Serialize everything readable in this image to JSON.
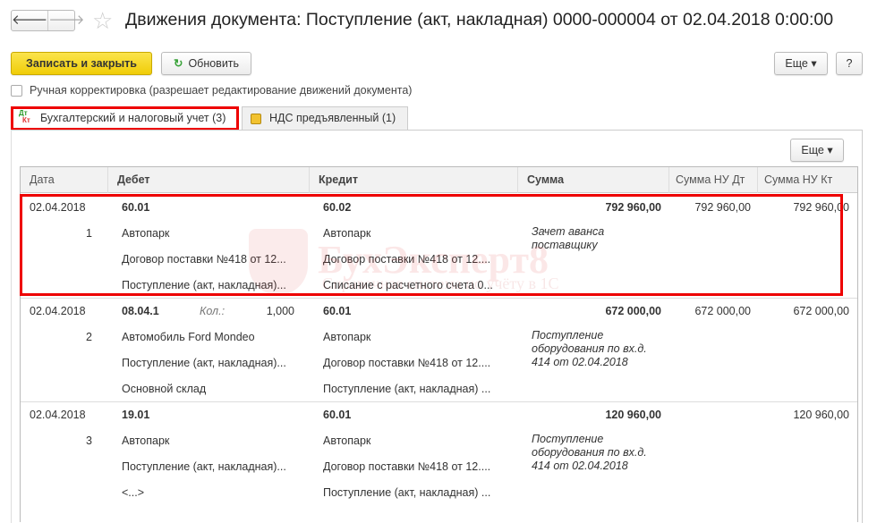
{
  "header": {
    "title": "Движения документа: Поступление (акт, накладная) 0000-000004 от 02.04.2018 0:00:00",
    "back": "🡐",
    "forward": "🡒",
    "star": "☆"
  },
  "toolbar": {
    "save_close": "Записать и закрыть",
    "refresh": "Обновить",
    "refresh_icon": "↻",
    "more": "Еще ▾",
    "help": "?"
  },
  "manual": {
    "label": "Ручная корректировка (разрешает редактирование движений документа)"
  },
  "tabs": [
    {
      "label": "Бухгалтерский и налоговый учет (3)",
      "icon_top": "Дт",
      "icon_bottom": "Кт"
    },
    {
      "label": "НДС предъявленный (1)"
    }
  ],
  "table": {
    "more": "Еще ▾",
    "columns": [
      "Дата",
      "Дебет",
      "Кредит",
      "Сумма",
      "Сумма НУ Дт",
      "Сумма НУ Кт"
    ],
    "rows": [
      {
        "date": "02.04.2018",
        "num": "1",
        "debit": [
          "60.01",
          "Автопарк",
          "Договор поставки №418 от 12...",
          "Поступление (акт, накладная)..."
        ],
        "credit": [
          "60.02",
          "Автопарк",
          "Договор поставки №418 от 12....",
          "Списание с расчетного счета 0..."
        ],
        "sum": "792 960,00",
        "content": "Зачет аванса поставщику",
        "nu_dt": "792 960,00",
        "nu_kt": "792 960,00",
        "kol_label": "",
        "kol": ""
      },
      {
        "date": "02.04.2018",
        "num": "2",
        "debit": [
          "08.04.1",
          "Автомобиль Ford Mondeo",
          "Поступление (акт, накладная)...",
          "Основной склад"
        ],
        "credit": [
          "60.01",
          "Автопарк",
          "Договор поставки №418 от 12....",
          "Поступление (акт, накладная) ..."
        ],
        "sum": "672 000,00",
        "content": "Поступление оборудования по вх.д. 414 от 02.04.2018",
        "nu_dt": "672 000,00",
        "nu_kt": "672 000,00",
        "kol_label": "Кол.:",
        "kol": "1,000"
      },
      {
        "date": "02.04.2018",
        "num": "3",
        "debit": [
          "19.01",
          "Автопарк",
          "Поступление (акт, накладная)...",
          "<...>"
        ],
        "credit": [
          "60.01",
          "Автопарк",
          "Договор поставки №418 от 12....",
          "Поступление (акт, накладная) ..."
        ],
        "sum": "120 960,00",
        "content": "Поступление оборудования по вх.д. 414 от 02.04.2018",
        "nu_dt": "",
        "nu_kt": "120 960,00",
        "kol_label": "",
        "kol": ""
      }
    ]
  },
  "watermark": {
    "title": "БухЭксперт8",
    "subtitle": "Справочная система по учёту в 1С"
  },
  "colors": {
    "primary": "#f5d31c",
    "highlight": "#ee0000"
  }
}
